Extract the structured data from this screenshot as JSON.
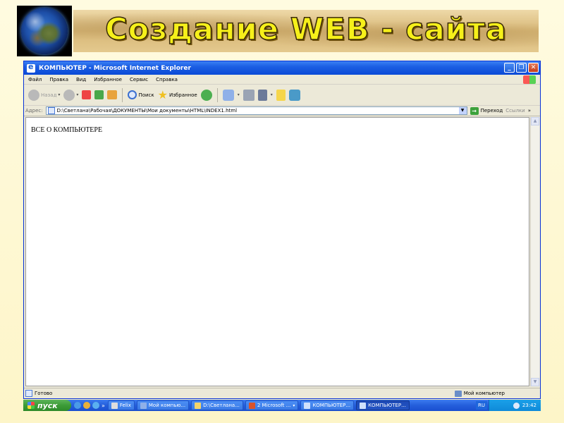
{
  "slide": {
    "title": "Создание WEB - сайта"
  },
  "window": {
    "title": "КОМПЬЮТЕР - Microsoft Internet Explorer"
  },
  "menu": [
    "Файл",
    "Правка",
    "Вид",
    "Избранное",
    "Сервис",
    "Справка"
  ],
  "toolbar": {
    "back": "Назад",
    "search": "Поиск",
    "favorites": "Избранное"
  },
  "address": {
    "label": "Адрес:",
    "value": "D:\\Светлана\\Рабочая\\ДОКУМЕНТЫ\\Мои документы\\HTML\\INDEX1.html",
    "go": "Переход",
    "links": "Ссылки"
  },
  "page": {
    "text": "ВСЕ О КОМПЬЮТЕРЕ"
  },
  "status": {
    "text": "Готово",
    "zone": "Мой компьютер"
  },
  "taskbar": {
    "start": "пуск",
    "chevron": "»",
    "buttons": [
      {
        "label": "Felix",
        "active": false
      },
      {
        "label": "Мой компью...",
        "active": false
      },
      {
        "label": "D:\\Светлана...",
        "active": false
      },
      {
        "label": "2 Microsoft ...",
        "active": false
      },
      {
        "label": "КОМПЬЮТЕР...",
        "active": false
      },
      {
        "label": "КОМПЬЮТЕР...",
        "active": true
      }
    ],
    "lang": "RU",
    "clock": "23:42"
  },
  "colors": {
    "background": "#fdf5c8",
    "title_text": "#f6f01a",
    "ie_titlebar": "#0a4ad6",
    "taskbar": "#245edb",
    "start_button": "#3c9b37"
  }
}
